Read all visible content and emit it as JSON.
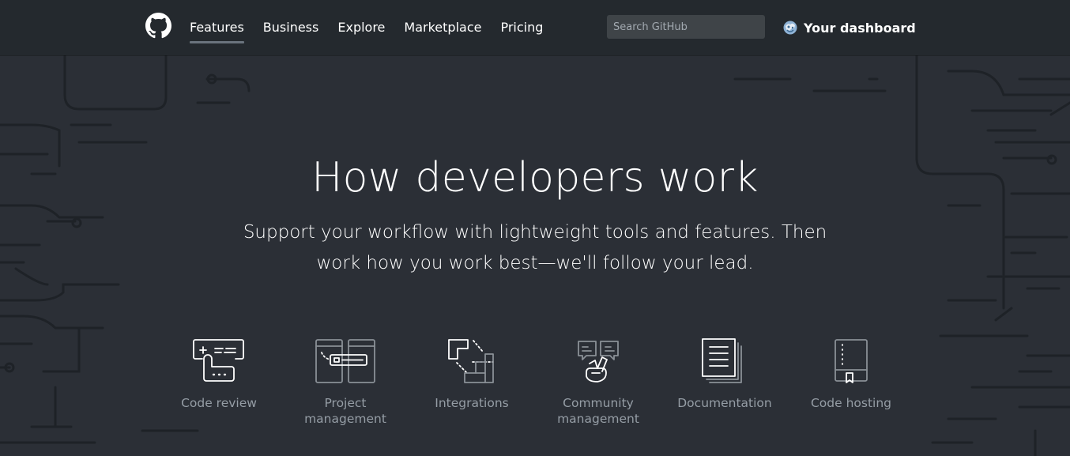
{
  "header": {
    "nav": [
      {
        "label": "Features",
        "active": true
      },
      {
        "label": "Business"
      },
      {
        "label": "Explore"
      },
      {
        "label": "Marketplace"
      },
      {
        "label": "Pricing"
      }
    ],
    "search_placeholder": "Search GitHub",
    "dashboard_label": "Your dashboard"
  },
  "hero": {
    "title": "How developers work",
    "subtitle": "Support your workflow with lightweight tools and features. Then work how you work best—we'll follow your lead."
  },
  "features": [
    {
      "icon": "code-review-icon",
      "label": "Code review"
    },
    {
      "icon": "project-management-icon",
      "label": "Project management"
    },
    {
      "icon": "integrations-icon",
      "label": "Integrations"
    },
    {
      "icon": "community-management-icon",
      "label": "Community management"
    },
    {
      "icon": "documentation-icon",
      "label": "Documentation"
    },
    {
      "icon": "code-hosting-icon",
      "label": "Code hosting"
    }
  ],
  "colors": {
    "header_bg": "#24292e",
    "hero_bg": "#2b2f36",
    "circuit": "#1f2328",
    "muted_text": "#959da5"
  }
}
